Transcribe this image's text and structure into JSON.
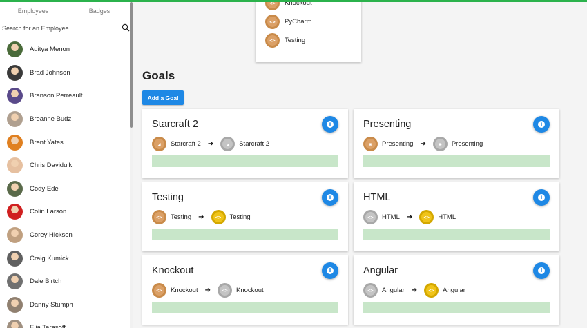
{
  "sidebar": {
    "tabs": [
      "Employees",
      "Badges"
    ],
    "search_placeholder": "Search for an Employee",
    "employees": [
      {
        "name": "Aditya Menon",
        "avatar_color": "#4a6b3a"
      },
      {
        "name": "Brad Johnson",
        "avatar_color": "#3a3a3a"
      },
      {
        "name": "Branson Perreault",
        "avatar_color": "#5a4a8a"
      },
      {
        "name": "Breanne Budz",
        "avatar_color": "#b0a090"
      },
      {
        "name": "Brent Yates",
        "avatar_color": "#e08020"
      },
      {
        "name": "Chris Daviduik",
        "avatar_color": "#e6c0a0"
      },
      {
        "name": "Cody Ede",
        "avatar_color": "#5a6a4a"
      },
      {
        "name": "Colin Larson",
        "avatar_color": "#d02020"
      },
      {
        "name": "Corey Hickson",
        "avatar_color": "#c0a080"
      },
      {
        "name": "Craig Kumick",
        "avatar_color": "#606060"
      },
      {
        "name": "Dale Birtch",
        "avatar_color": "#707070"
      },
      {
        "name": "Danny Stumph",
        "avatar_color": "#908070"
      },
      {
        "name": "Elia Tarasoff",
        "avatar_color": "#a09080"
      }
    ]
  },
  "badge_panel": {
    "items": [
      {
        "label": "Knockout",
        "tier": "bronze",
        "icon": "code-icon"
      },
      {
        "label": "PyCharm",
        "tier": "bronze",
        "icon": "code-icon"
      },
      {
        "label": "Testing",
        "tier": "bronze",
        "icon": "code-icon"
      }
    ]
  },
  "goals": {
    "title": "Goals",
    "add_button": "Add a Goal",
    "info_icon": "i",
    "arrow_glyph": "➔",
    "cards": [
      {
        "title": "Starcraft 2",
        "from": {
          "label": "Starcraft 2",
          "tier": "bronze",
          "icon": "starcraft-icon"
        },
        "to": {
          "label": "Starcraft 2",
          "tier": "silver",
          "icon": "starcraft-icon"
        }
      },
      {
        "title": "Presenting",
        "from": {
          "label": "Presenting",
          "tier": "bronze",
          "icon": "presenting-icon"
        },
        "to": {
          "label": "Presenting",
          "tier": "silver",
          "icon": "presenting-icon"
        }
      },
      {
        "title": "Testing",
        "from": {
          "label": "Testing",
          "tier": "bronze",
          "icon": "code-icon"
        },
        "to": {
          "label": "Testing",
          "tier": "gold",
          "icon": "code-icon"
        }
      },
      {
        "title": "HTML",
        "from": {
          "label": "HTML",
          "tier": "silver",
          "icon": "code-icon"
        },
        "to": {
          "label": "HTML",
          "tier": "gold",
          "icon": "code-icon"
        }
      },
      {
        "title": "Knockout",
        "from": {
          "label": "Knockout",
          "tier": "bronze",
          "icon": "code-icon"
        },
        "to": {
          "label": "Knockout",
          "tier": "silver",
          "icon": "code-icon"
        }
      },
      {
        "title": "Angular",
        "from": {
          "label": "Angular",
          "tier": "silver",
          "icon": "code-icon"
        },
        "to": {
          "label": "Angular",
          "tier": "gold",
          "icon": "code-icon"
        }
      }
    ]
  },
  "colors": {
    "accent": "#1e88e5",
    "progress": "#c8e6c9",
    "top_bar": "#2bb24c"
  }
}
